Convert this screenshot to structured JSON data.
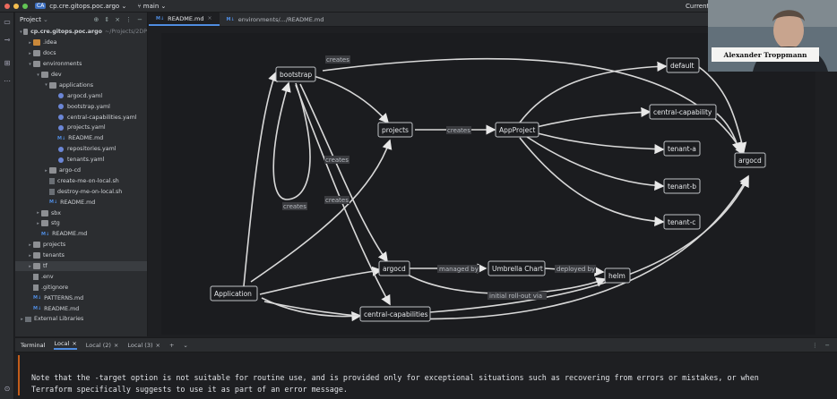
{
  "titlebar": {
    "project_badge": "CA",
    "project_name": "cp.cre.gitops.poc.argo",
    "branch": "main",
    "current_label": "Current"
  },
  "project_panel": {
    "title": "Project",
    "items": [
      {
        "depth": 0,
        "expand": "open",
        "icon": "folder",
        "label": "cp.cre.gitops.poc.argo",
        "suffix": "~/Projects/2DP"
      },
      {
        "depth": 1,
        "expand": "closed",
        "icon": "folder-orange",
        "label": ".idea"
      },
      {
        "depth": 1,
        "expand": "closed",
        "icon": "folder",
        "label": "docs"
      },
      {
        "depth": 1,
        "expand": "open",
        "icon": "folder",
        "label": "environments"
      },
      {
        "depth": 2,
        "expand": "open",
        "icon": "folder",
        "label": "dev"
      },
      {
        "depth": 3,
        "expand": "open",
        "icon": "folder",
        "label": "applications"
      },
      {
        "depth": 4,
        "expand": "none",
        "icon": "yaml",
        "label": "argocd.yaml"
      },
      {
        "depth": 4,
        "expand": "none",
        "icon": "yaml",
        "label": "bootstrap.yaml"
      },
      {
        "depth": 4,
        "expand": "none",
        "icon": "yaml",
        "label": "central-capabilities.yaml"
      },
      {
        "depth": 4,
        "expand": "none",
        "icon": "yaml",
        "label": "projects.yaml"
      },
      {
        "depth": 4,
        "expand": "none",
        "icon": "md",
        "label": "README.md"
      },
      {
        "depth": 4,
        "expand": "none",
        "icon": "yaml",
        "label": "repositories.yaml"
      },
      {
        "depth": 4,
        "expand": "none",
        "icon": "yaml",
        "label": "tenants.yaml"
      },
      {
        "depth": 3,
        "expand": "closed",
        "icon": "folder",
        "label": "argo-cd"
      },
      {
        "depth": 3,
        "expand": "none",
        "icon": "sh",
        "label": "create-me-on-local.sh"
      },
      {
        "depth": 3,
        "expand": "none",
        "icon": "sh",
        "label": "destroy-me-on-local.sh"
      },
      {
        "depth": 3,
        "expand": "none",
        "icon": "md",
        "label": "README.md"
      },
      {
        "depth": 2,
        "expand": "closed",
        "icon": "folder",
        "label": "sbx"
      },
      {
        "depth": 2,
        "expand": "closed",
        "icon": "folder",
        "label": "stg"
      },
      {
        "depth": 2,
        "expand": "none",
        "icon": "md",
        "label": "README.md"
      },
      {
        "depth": 1,
        "expand": "closed",
        "icon": "folder",
        "label": "projects"
      },
      {
        "depth": 1,
        "expand": "closed",
        "icon": "folder",
        "label": "tenants"
      },
      {
        "depth": 1,
        "expand": "closed",
        "icon": "folder",
        "label": "tf",
        "selected": true
      },
      {
        "depth": 1,
        "expand": "none",
        "icon": "file",
        "label": ".env"
      },
      {
        "depth": 1,
        "expand": "none",
        "icon": "file",
        "label": ".gitignore"
      },
      {
        "depth": 1,
        "expand": "none",
        "icon": "md",
        "label": "PATTERNS.md"
      },
      {
        "depth": 1,
        "expand": "none",
        "icon": "md",
        "label": "README.md"
      },
      {
        "depth": 0,
        "expand": "closed",
        "icon": "lib",
        "label": "External Libraries"
      }
    ]
  },
  "editor_tabs": [
    {
      "badge": "M↓",
      "label": "README.md",
      "active": true
    },
    {
      "badge": "M↓",
      "label": "environments/.../README.md",
      "active": false
    }
  ],
  "diagram": {
    "nodes": {
      "bootstrap": "bootstrap",
      "projects": "projects",
      "appproject": "AppProject",
      "default": "default",
      "central_capability": "central-capability",
      "tenant_a": "tenant-a",
      "tenant_b": "tenant-b",
      "tenant_c": "tenant-c",
      "argocd_right": "argocd",
      "argocd": "argocd",
      "umbrella": "Umbrella Chart",
      "helm": "helm",
      "application": "Application",
      "central_capabilities": "central-capabilities"
    },
    "edge_labels": {
      "creates_top": "creates",
      "creates_projects": "creates",
      "creates_mid1": "creates",
      "creates_mid2": "creates",
      "creates_loop": "creates",
      "managed_by": "managed by",
      "deployed_by": "deployed by",
      "initial_rollout": "initial roll-out via"
    }
  },
  "webcam": {
    "name": "Alexander Troppmann"
  },
  "terminal": {
    "title": "Terminal",
    "tabs": [
      "Local",
      "Local (2)",
      "Local (3)"
    ],
    "lines": [
      "Note that the -target option is not suitable for routine use, and is provided only for exceptional situations such as recovering from errors or mistakes, or when",
      "Terraform specifically suggests to use it as part of an error message."
    ]
  }
}
